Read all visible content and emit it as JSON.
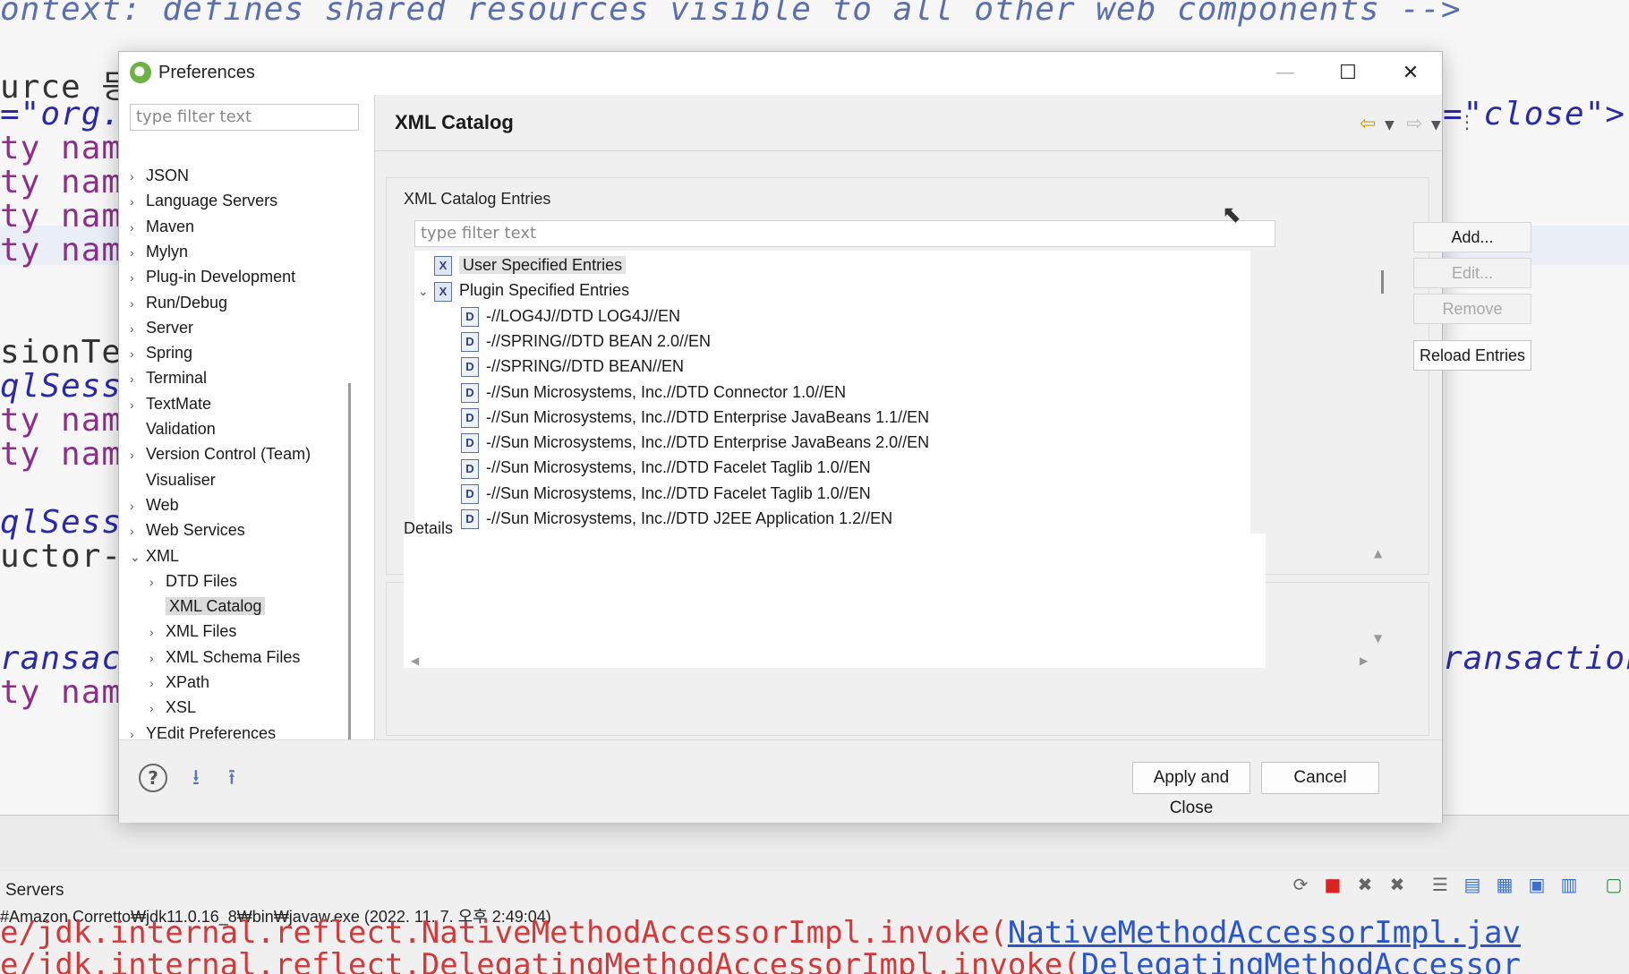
{
  "background_editor": {
    "lines": [
      {
        "text": "ontext: defines shared resources visible to all other web components -->"
      },
      {
        "text": "urce 등"
      },
      {
        "text": "=\"org."
      },
      {
        "text": "ty name"
      },
      {
        "text": "ty name"
      },
      {
        "text": "ty name"
      },
      {
        "text": "ty name"
      },
      {
        "text": "sionTe"
      },
      {
        "text": "qlSess"
      },
      {
        "text": "ty name"
      },
      {
        "text": "ty name"
      },
      {
        "text": "qlSess"
      },
      {
        "text": "uctor-a"
      },
      {
        "text": "ransac"
      },
      {
        "text": "ty name"
      }
    ],
    "right_fragments": {
      "close": "=\"close\">",
      "transaction": "ransaction"
    }
  },
  "console": {
    "tab_label": "Servers",
    "path_text": "#Amazon Corretto₩jdk11.0.16_8₩bin₩javaw.exe  (2022. 11. 7. 오후 2:49:04)",
    "line1": "e/jdk.internal.reflect.NativeMethodAccessorImpl.invoke(",
    "line1_link": "NativeMethodAccessorImpl.jav",
    "line2": "e/jdk.internal.reflect.DelegatingMethodAccessorImpl.invoke(",
    "line2_link": "DelegatingMethodAccessor"
  },
  "dialog": {
    "title": "Preferences",
    "window_controls": {
      "minimize": "—",
      "maximize": "☐",
      "close": "✕"
    },
    "sidebar": {
      "filter_placeholder": "type filter text",
      "items": [
        {
          "label": "JSON",
          "expander": "›",
          "level": 0
        },
        {
          "label": "Language Servers",
          "expander": "›",
          "level": 0
        },
        {
          "label": "Maven",
          "expander": "›",
          "level": 0
        },
        {
          "label": "Mylyn",
          "expander": "›",
          "level": 0
        },
        {
          "label": "Plug-in Development",
          "expander": "›",
          "level": 0
        },
        {
          "label": "Run/Debug",
          "expander": "›",
          "level": 0
        },
        {
          "label": "Server",
          "expander": "›",
          "level": 0
        },
        {
          "label": "Spring",
          "expander": "›",
          "level": 0
        },
        {
          "label": "Terminal",
          "expander": "›",
          "level": 0
        },
        {
          "label": "TextMate",
          "expander": "›",
          "level": 0
        },
        {
          "label": "Validation",
          "expander": "",
          "level": 0
        },
        {
          "label": "Version Control (Team)",
          "expander": "›",
          "level": 0
        },
        {
          "label": "Visualiser",
          "expander": "",
          "level": 0
        },
        {
          "label": "Web",
          "expander": "›",
          "level": 0
        },
        {
          "label": "Web Services",
          "expander": "›",
          "level": 0
        },
        {
          "label": "XML",
          "expander": "⌄",
          "level": 0
        },
        {
          "label": "DTD Files",
          "expander": "›",
          "level": 1
        },
        {
          "label": "XML Catalog",
          "expander": "",
          "level": 1,
          "selected": true
        },
        {
          "label": "XML Files",
          "expander": "›",
          "level": 1
        },
        {
          "label": "XML Schema Files",
          "expander": "›",
          "level": 1
        },
        {
          "label": "XPath",
          "expander": "›",
          "level": 1
        },
        {
          "label": "XSL",
          "expander": "›",
          "level": 1
        },
        {
          "label": "YEdit Preferences",
          "expander": "›",
          "level": 0
        }
      ]
    },
    "page": {
      "title": "XML Catalog",
      "entries_group_label": "XML Catalog Entries",
      "entries_filter_placeholder": "type filter text",
      "entries": [
        {
          "label": "User Specified Entries",
          "icon": "X",
          "expander": "",
          "level": 0,
          "highlight": true
        },
        {
          "label": "Plugin Specified Entries",
          "icon": "X",
          "expander": "⌄",
          "level": 0
        },
        {
          "label": "-//LOG4J//DTD LOG4J//EN",
          "icon": "D",
          "expander": "",
          "level": 1
        },
        {
          "label": "-//SPRING//DTD BEAN 2.0//EN",
          "icon": "D",
          "expander": "",
          "level": 1
        },
        {
          "label": "-//SPRING//DTD BEAN//EN",
          "icon": "D",
          "expander": "",
          "level": 1
        },
        {
          "label": "-//Sun Microsystems, Inc.//DTD Connector 1.0//EN",
          "icon": "D",
          "expander": "",
          "level": 1
        },
        {
          "label": "-//Sun Microsystems, Inc.//DTD Enterprise JavaBeans 1.1//EN",
          "icon": "D",
          "expander": "",
          "level": 1
        },
        {
          "label": "-//Sun Microsystems, Inc.//DTD Enterprise JavaBeans 2.0//EN",
          "icon": "D",
          "expander": "",
          "level": 1
        },
        {
          "label": "-//Sun Microsystems, Inc.//DTD Facelet Taglib 1.0//EN",
          "icon": "D",
          "expander": "",
          "level": 1
        },
        {
          "label": "-//Sun Microsystems, Inc.//DTD Facelet Taglib 1.0//EN",
          "icon": "D",
          "expander": "",
          "level": 1
        },
        {
          "label": "-//Sun Microsystems, Inc.//DTD J2EE Application 1.2//EN",
          "icon": "D",
          "expander": "",
          "level": 1
        }
      ],
      "buttons": {
        "add": "Add...",
        "edit": "Edit...",
        "remove": "Remove",
        "reload": "Reload Entries"
      },
      "details_label": "Details"
    },
    "footer": {
      "help": "?",
      "apply_close": "Apply and Close",
      "cancel": "Cancel"
    }
  }
}
